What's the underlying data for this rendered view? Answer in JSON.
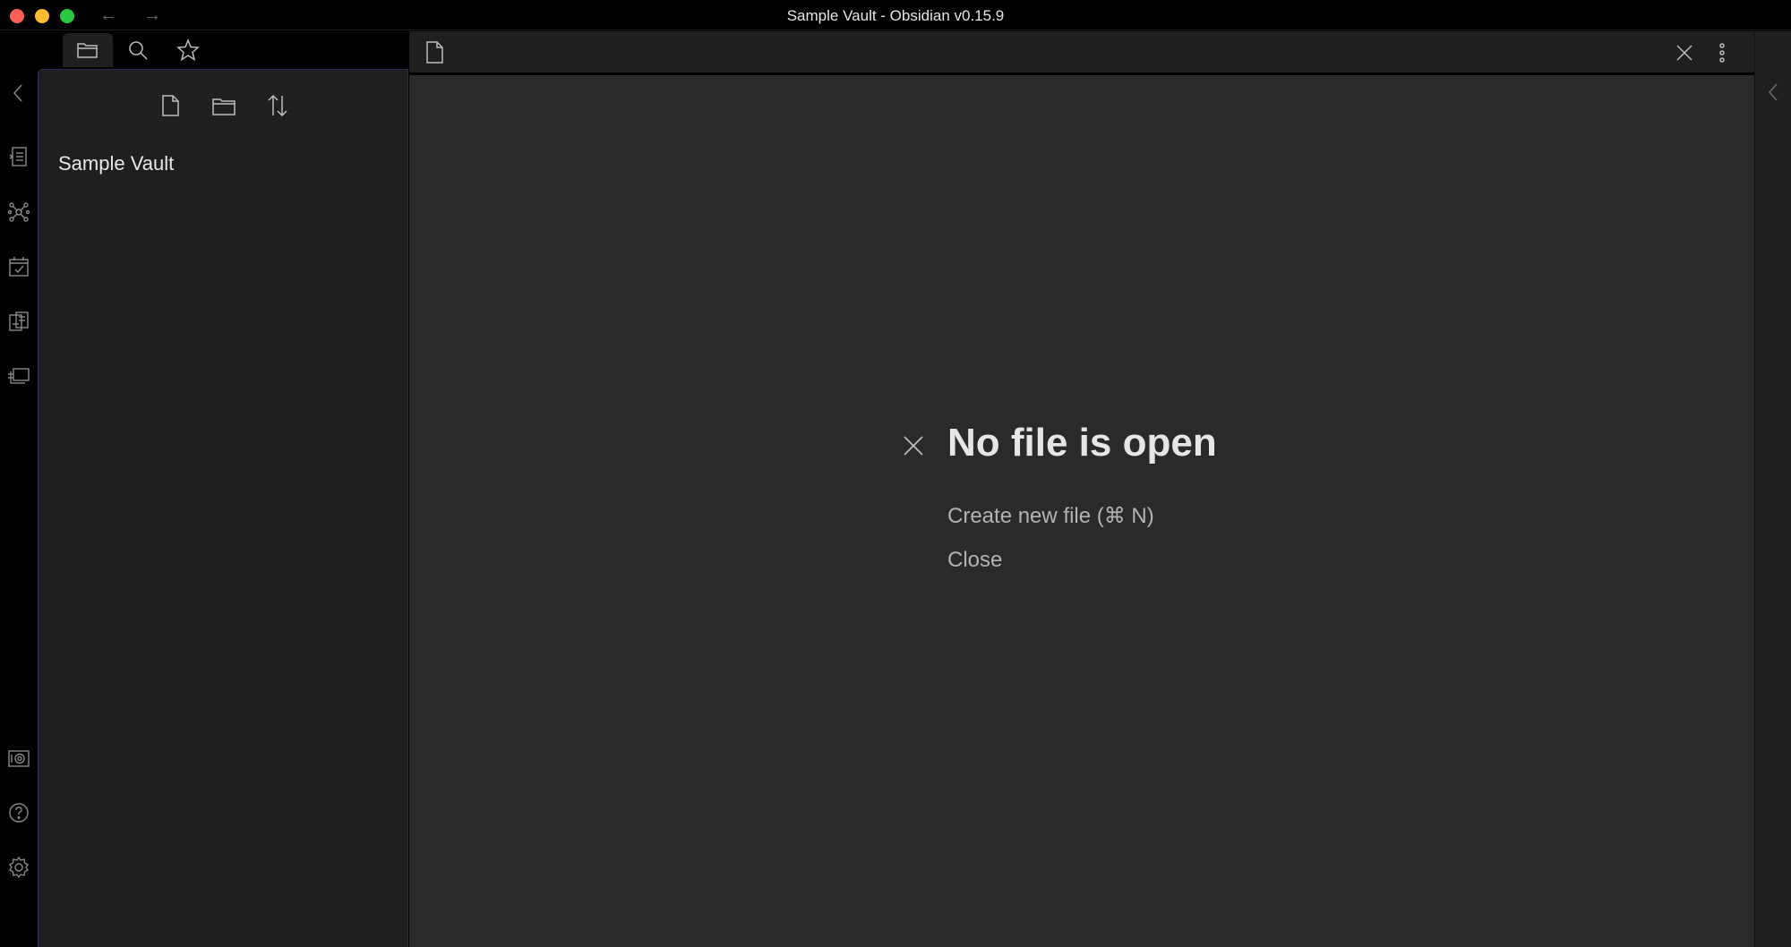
{
  "window": {
    "title": "Sample Vault - Obsidian v0.15.9",
    "nav_back": "←",
    "nav_forward": "→"
  },
  "ribbon": {
    "items": [
      "collapse-left-icon",
      "switcher-icon",
      "graph-view-icon",
      "daily-note-icon",
      "templates-icon",
      "slides-icon"
    ],
    "bottom_items": [
      "vault-icon",
      "help-icon",
      "settings-icon"
    ]
  },
  "sidebar": {
    "tabs": [
      "file-explorer-icon",
      "search-icon",
      "star-icon"
    ],
    "actions": [
      "new-note-icon",
      "new-folder-icon",
      "sort-icon"
    ],
    "vault_name": "Sample Vault"
  },
  "main": {
    "empty_state": {
      "title": "No file is open",
      "create_label": "Create new file (⌘ N)",
      "close_label": "Close"
    }
  },
  "colors": {
    "background": "#000000",
    "sidebar": "#1f1f1f",
    "editor": "#2a2a2a",
    "accent_border": "#2a2a55"
  }
}
